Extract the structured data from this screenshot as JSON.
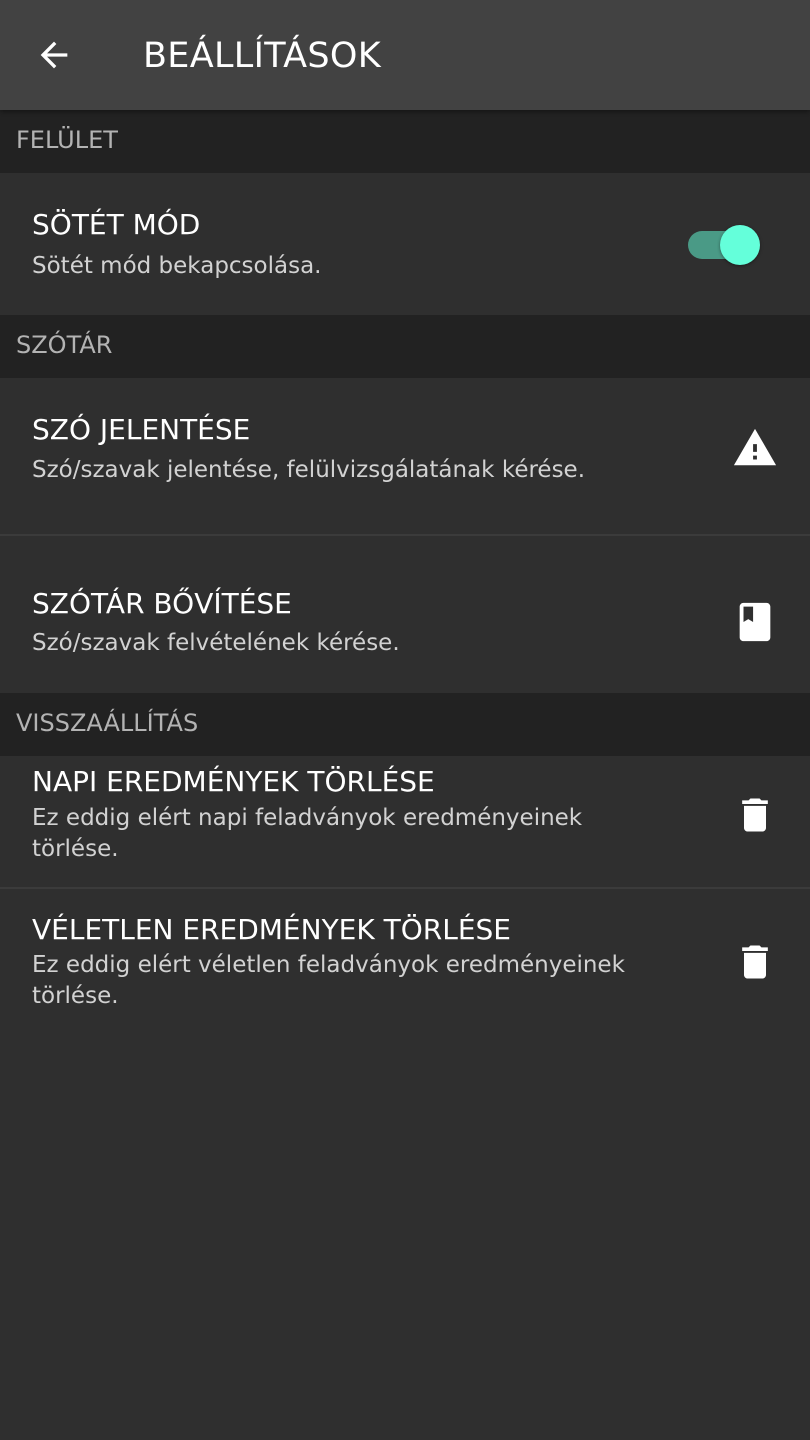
{
  "appbar": {
    "title": "BEÁLLÍTÁSOK",
    "back_icon": "arrow-left-icon"
  },
  "colors": {
    "appbar_bg": "#424242",
    "background": "#2f2f2f",
    "section_bg": "#222222",
    "accent": "#64ffda",
    "accent_track": "#4a9a86"
  },
  "sections": {
    "interface": {
      "header": "FELÜLET",
      "dark_mode": {
        "title": "SÖTÉT MÓD",
        "summary": "Sötét mód bekapcsolása.",
        "enabled": true
      }
    },
    "dictionary": {
      "header": "SZÓTÁR",
      "report_word": {
        "title": "SZÓ JELENTÉSE",
        "summary": "Szó/szavak jelentése, felülvizsgálatának kérése.",
        "icon": "warning-icon"
      },
      "expand_dictionary": {
        "title": "SZÓTÁR BŐVÍTÉSE",
        "summary": "Szó/szavak felvételének kérése.",
        "icon": "book-icon"
      }
    },
    "reset": {
      "header": "VISSZAÁLLÍTÁS",
      "delete_daily": {
        "title": "NAPI EREDMÉNYEK TÖRLÉSE",
        "summary": "Ez eddig elért napi feladványok eredményeinek törlése.",
        "icon": "trash-icon"
      },
      "delete_random": {
        "title": "VÉLETLEN EREDMÉNYEK TÖRLÉSE",
        "summary": "Ez eddig elért véletlen feladványok eredményeinek törlése.",
        "icon": "trash-icon"
      }
    }
  }
}
